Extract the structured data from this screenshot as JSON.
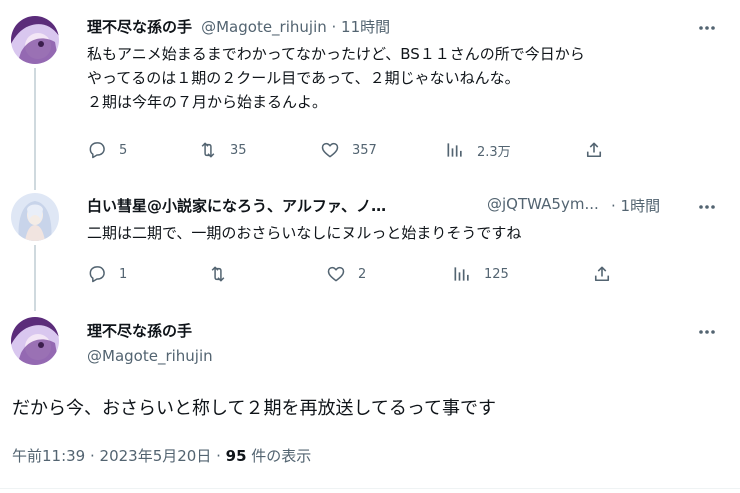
{
  "colors": {
    "text": "#0f1419",
    "secondary": "#536471",
    "line": "#cfd9de"
  },
  "tweet1": {
    "name": "理不尽な孫の手",
    "handle_time": "@Magote_rihujin · 11時間",
    "text": "私もアニメ始まるまでわかってなかったけど、BS１１さんの所で今日から\nやってるのは１期の２クール目であって、２期じゃないねんな。\n２期は今年の７月から始まるんよ。",
    "replies": "5",
    "retweets": "35",
    "likes": "357",
    "views": "2.3万"
  },
  "tweet2": {
    "name": "白い彗星@小説家になろう、アルファ、ノ…",
    "handle": "@jQTWA5ym...",
    "time": "· 1時間",
    "text": "二期は二期で、一期のおさらいなしにヌルっと始まりそうですね",
    "replies": "1",
    "retweets": "",
    "likes": "2",
    "views": "125"
  },
  "tweet3": {
    "name": "理不尽な孫の手",
    "handle": "@Magote_rihujin",
    "text": "だから今、おさらいと称して２期を再放送してるって事です",
    "timestamp": "午前11:39 · 2023年5月20日 · ",
    "view_count": "95",
    "view_label": " 件の表示"
  }
}
